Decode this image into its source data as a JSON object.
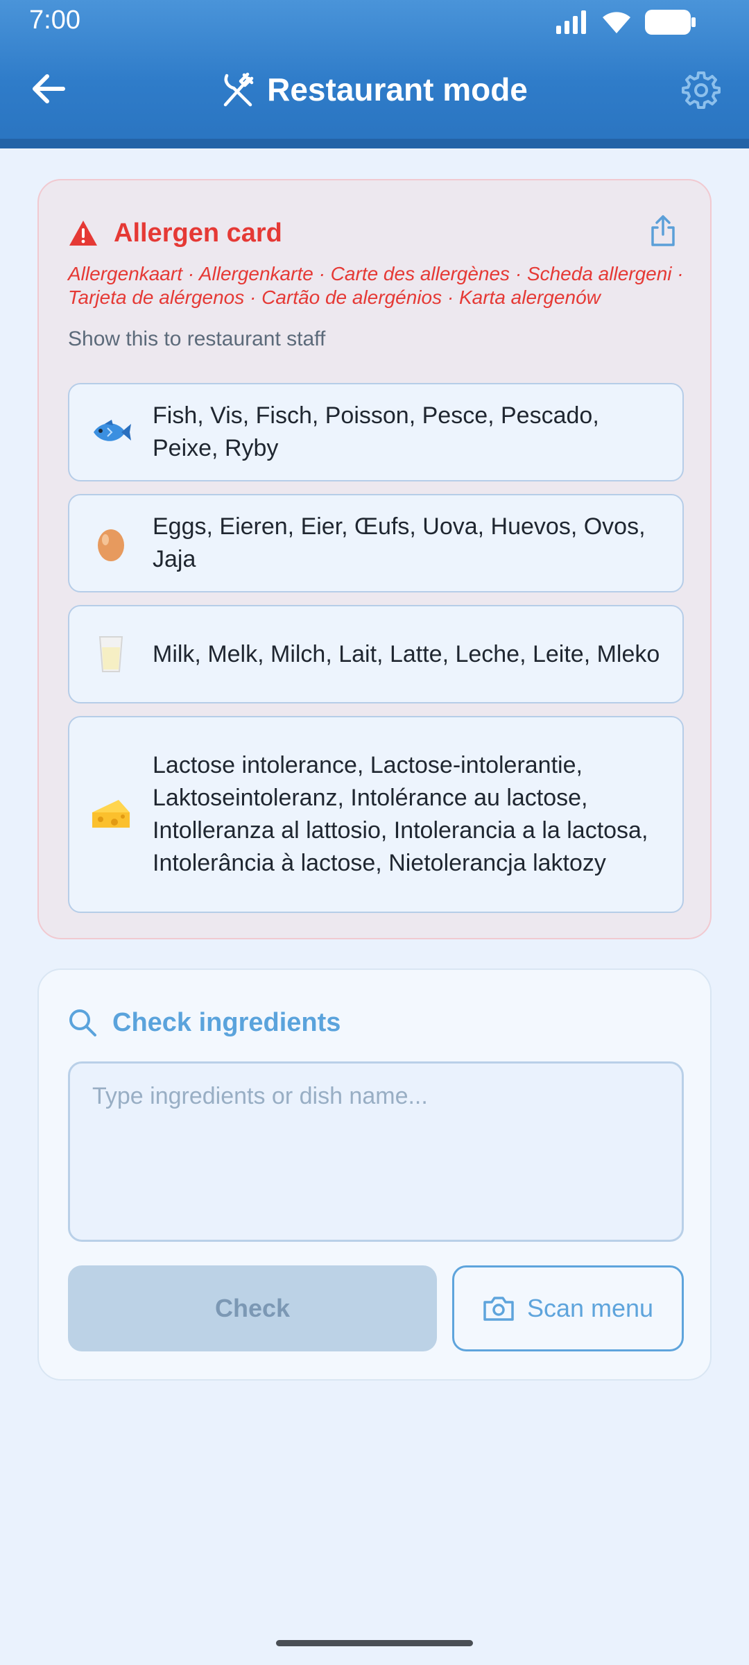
{
  "status_bar": {
    "time": "7:00",
    "icons": [
      "signal-icon",
      "wifi-icon",
      "battery-icon"
    ]
  },
  "header": {
    "title": "Restaurant mode",
    "back_icon": "arrow-left-icon",
    "title_icon": "fork-knife-icon",
    "settings_icon": "gear-icon"
  },
  "allergen_card": {
    "title": "Allergen card",
    "translations": "Allergenkaart · Allergenkarte · Carte des allergènes · Scheda allergeni · Tarjeta de alérgenos · Cartão de alergénios · Karta alergenów",
    "instruction": "Show this to restaurant staff",
    "items": [
      {
        "emoji": "🐟",
        "text": "Fish, Vis, Fisch, Poisson, Pesce, Pescado, Peixe, Ryby"
      },
      {
        "emoji": "🥚",
        "text": "Eggs, Eieren, Eier, Œufs, Uova, Huevos, Ovos, Jaja"
      },
      {
        "emoji": "🥛",
        "text": "Milk, Melk, Milch, Lait, Latte, Leche, Leite, Mleko"
      },
      {
        "emoji": "🧀",
        "text": "Lactose intolerance, Lactose-intolerantie, Laktoseintoleranz, Intolérance au lactose, Intolleranza al lattosio, Intolerancia a la lactosa, Intolerância à lactose, Nietolerancja laktozy"
      }
    ]
  },
  "check_card": {
    "title": "Check ingredients",
    "input_placeholder": "Type ingredients or dish name...",
    "input_value": "",
    "check_button": "Check",
    "scan_button": "Scan menu"
  },
  "colors": {
    "header": "#2f7cc9",
    "danger": "#e53935",
    "accent": "#5aa3dc",
    "background": "#eaf2fd"
  }
}
